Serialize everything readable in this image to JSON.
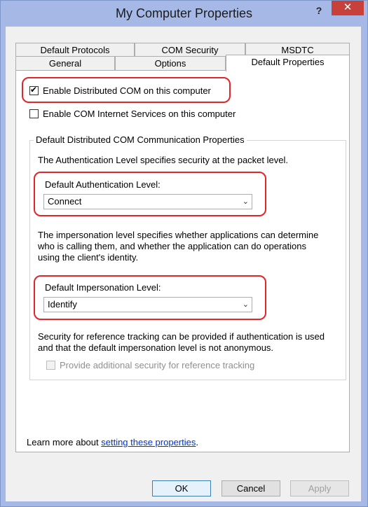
{
  "window": {
    "title": "My Computer Properties",
    "help_label": "?",
    "close_label": "✕"
  },
  "tabs": {
    "row1": [
      "Default Protocols",
      "COM Security",
      "MSDTC"
    ],
    "row2": [
      "General",
      "Options",
      "Default Properties"
    ],
    "active": "Default Properties"
  },
  "options": {
    "enable_dcom": {
      "label": "Enable Distributed COM on this computer",
      "checked": true
    },
    "enable_cis": {
      "label": "Enable COM Internet Services on this computer",
      "checked": false
    }
  },
  "group": {
    "title": "Default Distributed COM Communication Properties",
    "auth_desc": "The Authentication Level specifies security at the packet level.",
    "auth_label": "Default Authentication Level:",
    "auth_value": "Connect",
    "imp_desc_1": "The impersonation level specifies whether applications can determine",
    "imp_desc_2": "who is calling them, and whether the application can do operations",
    "imp_desc_3": "using the client's identity.",
    "imp_label": "Default Impersonation Level:",
    "imp_value": "Identify",
    "ref_desc_1": "Security for reference tracking can be provided if authentication is used",
    "ref_desc_2": "and that the default impersonation level is not anonymous.",
    "ref_check_label": "Provide additional security for reference tracking",
    "ref_check_checked": false
  },
  "footer": {
    "learn_more_prefix": "Learn more about ",
    "learn_more_link": "setting these properties",
    "learn_more_suffix": "."
  },
  "buttons": {
    "ok": "OK",
    "cancel": "Cancel",
    "apply": "Apply"
  },
  "colors": {
    "highlight": "#e0252b",
    "titlebar": "#a6b9e6",
    "close": "#c7413a",
    "link": "#0033cc"
  }
}
